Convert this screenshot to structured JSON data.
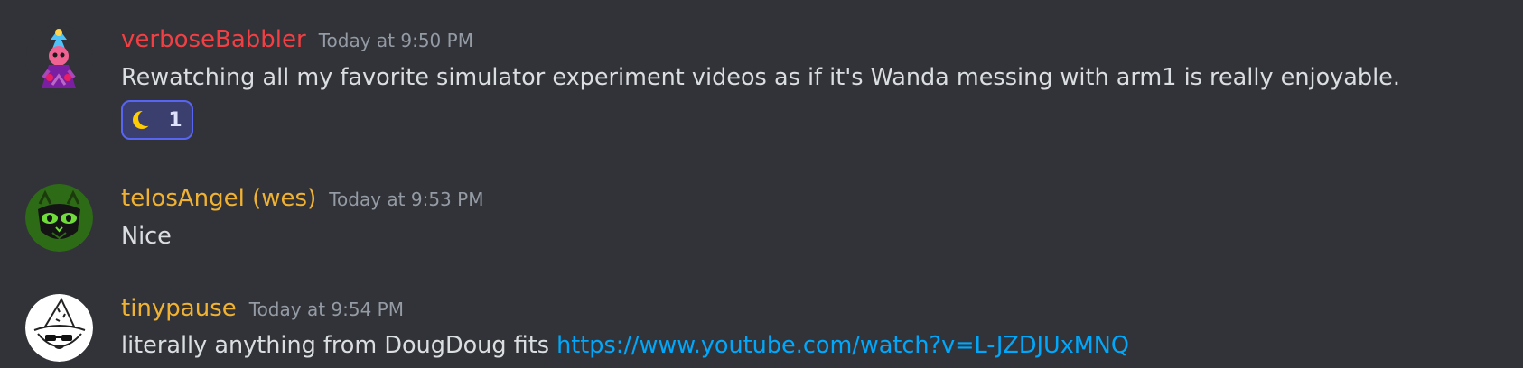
{
  "messages": [
    {
      "author": "verboseBabbler",
      "author_color": "#f23f43",
      "timestamp": "Today at 9:50 PM",
      "text": "Rewatching all my favorite simulator experiment videos as if it's Wanda messing with arm1 is really enjoyable.",
      "reaction": {
        "emoji": "crescent-moon-icon",
        "count": "1"
      }
    },
    {
      "author": "telosAngel (wes)",
      "author_color": "#f0b232",
      "timestamp": "Today at 9:53 PM",
      "text": "Nice"
    },
    {
      "author": "tinypause",
      "author_color": "#f0b232",
      "timestamp": "Today at 9:54 PM",
      "text": "literally anything from DougDoug fits ",
      "link": "https://www.youtube.com/watch?v=L-JZDJUxMNQ"
    }
  ],
  "colors": {
    "background": "#313338",
    "text": "#dbdee1",
    "timestamp": "#949ba4",
    "link": "#00a8fc",
    "reaction_border": "#5865f2"
  }
}
